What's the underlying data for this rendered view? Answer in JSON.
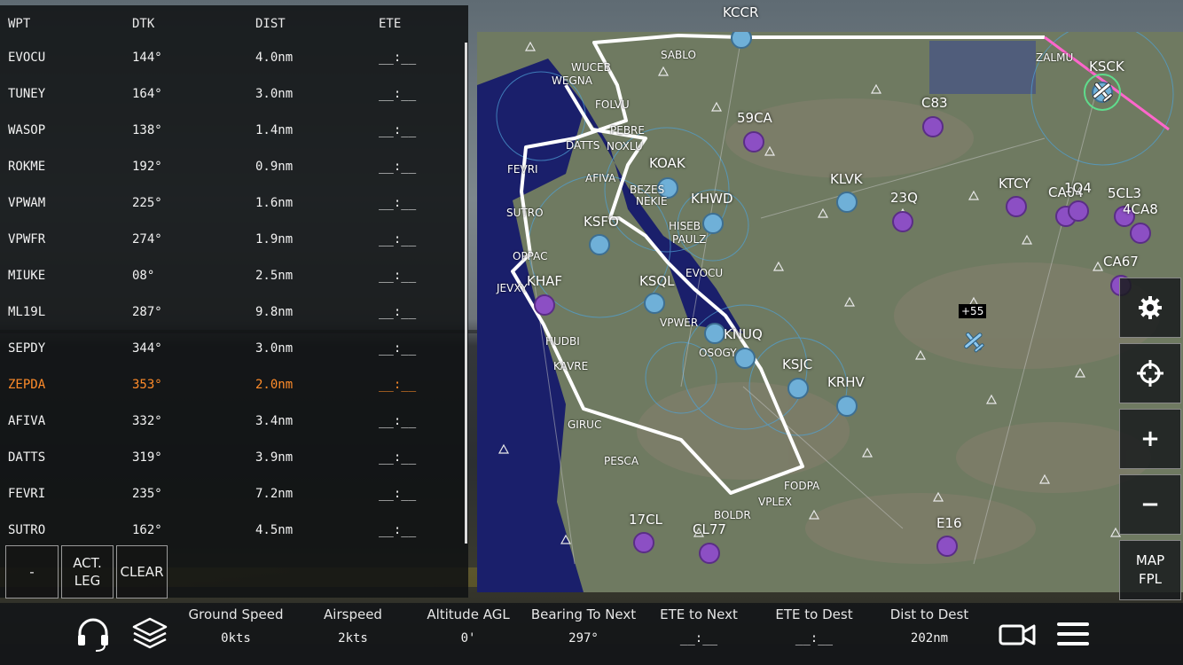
{
  "flight_plan": {
    "headers": {
      "wpt": "WPT",
      "dtk": "DTK",
      "dist": "DIST",
      "ete": "ETE"
    },
    "rows": [
      {
        "wpt": "EVOCU",
        "dtk": "144°",
        "dist": "4.0nm",
        "ete": "__:__"
      },
      {
        "wpt": "TUNEY",
        "dtk": "164°",
        "dist": "3.0nm",
        "ete": "__:__"
      },
      {
        "wpt": "WASOP",
        "dtk": "138°",
        "dist": "1.4nm",
        "ete": "__:__"
      },
      {
        "wpt": "ROKME",
        "dtk": "192°",
        "dist": "0.9nm",
        "ete": "__:__"
      },
      {
        "wpt": "VPWAM",
        "dtk": "225°",
        "dist": "1.6nm",
        "ete": "__:__"
      },
      {
        "wpt": "VPWFR",
        "dtk": "274°",
        "dist": "1.9nm",
        "ete": "__:__"
      },
      {
        "wpt": "MIUKE",
        "dtk": "08°",
        "dist": "2.5nm",
        "ete": "__:__"
      },
      {
        "wpt": "ML19L",
        "dtk": "287°",
        "dist": "9.8nm",
        "ete": "__:__"
      },
      {
        "wpt": "SEPDY",
        "dtk": "344°",
        "dist": "3.0nm",
        "ete": "__:__"
      },
      {
        "wpt": "ZEPDA",
        "dtk": "353°",
        "dist": "2.0nm",
        "ete": "__:__",
        "active": true
      },
      {
        "wpt": "AFIVA",
        "dtk": "332°",
        "dist": "3.4nm",
        "ete": "__:__"
      },
      {
        "wpt": "DATTS",
        "dtk": "319°",
        "dist": "3.9nm",
        "ete": "__:__"
      },
      {
        "wpt": "FEVRI",
        "dtk": "235°",
        "dist": "7.2nm",
        "ete": "__:__"
      },
      {
        "wpt": "SUTRO",
        "dtk": "162°",
        "dist": "4.5nm",
        "ete": "__:__"
      }
    ],
    "buttons": {
      "minus": "-",
      "act_leg_1": "ACT.",
      "act_leg_2": "LEG",
      "clear": "CLEAR"
    },
    "active_color": "#ff8c2a"
  },
  "map": {
    "airports_blue": [
      "KCCR",
      "KSCK",
      "KOAK",
      "KHWD",
      "KSFO",
      "KSQL",
      "KNUQ",
      "KSJC",
      "KRHV",
      "KLVK"
    ],
    "airports_purple": [
      "59CA",
      "C83",
      "23Q",
      "KTCY",
      "CA04",
      "1Q4",
      "5CL3",
      "4CA8",
      "CA67",
      "KHAF",
      "17CL",
      "CL77",
      "E16"
    ],
    "waypoints": [
      "SABLO",
      "ZALMU",
      "WUCEB",
      "WEGNA",
      "FOLVU",
      "PEBRE",
      "DATTS",
      "NOXLU",
      "FEVRI",
      "AFIVA",
      "SUTRO",
      "BEZES",
      "NEKIE",
      "HISEB",
      "PAULZ",
      "OPPAC",
      "JEVXY",
      "EVOCU",
      "HUDBI",
      "KAVRE",
      "VPWER",
      "OSOGY",
      "GIRUC",
      "PESCA",
      "FODPA",
      "VPLEX",
      "BOLDR"
    ],
    "labels": {
      "KCCR": "KCCR",
      "KSCK": "KSCK",
      "KOAK": "KOAK",
      "KHWD": "KHWD",
      "KSFO": "KSFO",
      "KSQL": "KSQL",
      "KNUQ": "KNUQ",
      "KSJC": "KSJC",
      "KRHV": "KRHV",
      "KLVK": "KLVK",
      "59CA": "59CA",
      "C83": "C83",
      "23Q": "23Q",
      "KTCY": "KTCY",
      "CA04": "CA04",
      "1Q4": "1Q4",
      "5CL3": "5CL3",
      "4CA8": "4CA8",
      "CA67": "CA67",
      "KHAF": "KHAF",
      "17CL": "17CL",
      "CL77": "CL77",
      "E16": "E16"
    },
    "traffic_tag": "+55",
    "route_color": "#ffffff",
    "leg_color": "#ff66cc",
    "water_color": "#1a1f6b",
    "land_color": "#6f7a61"
  },
  "side_controls": {
    "settings": "gear-icon",
    "center": "crosshair-icon",
    "zoom_in": "+",
    "zoom_out": "−",
    "map_fpl_1": "MAP",
    "map_fpl_2": "FPL"
  },
  "status_bar": {
    "items": [
      {
        "label": "Ground Speed",
        "value": "0kts"
      },
      {
        "label": "Airspeed",
        "value": "2kts"
      },
      {
        "label": "Altitude AGL",
        "value": "0'"
      },
      {
        "label": "Bearing To Next",
        "value": "297°"
      },
      {
        "label": "ETE to Next",
        "value": "__:__"
      },
      {
        "label": "ETE to Dest",
        "value": "__:__"
      },
      {
        "label": "Dist to Dest",
        "value": "202nm"
      }
    ],
    "icons": [
      "headset-icon",
      "layers-icon",
      "camera-icon",
      "menu-icon"
    ]
  }
}
